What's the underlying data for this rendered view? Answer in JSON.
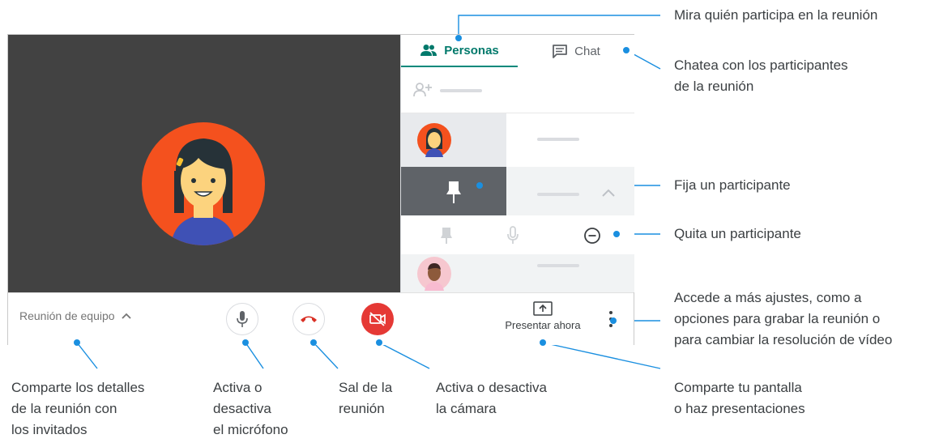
{
  "tabs": {
    "people": "Personas",
    "chat": "Chat"
  },
  "bottom_bar": {
    "meeting_name": "Reunión de equipo",
    "present_label": "Presentar ahora"
  },
  "annotations": {
    "people": "Mira quién participa en la reunión",
    "chat": "Chatea con los participantes\nde la reunión",
    "pin": "Fija un participante",
    "remove": "Quita un participante",
    "more": "Accede a más ajustes, como a\nopciones para grabar la reunión o\npara cambiar la resolución de vídeo",
    "present": "Comparte tu pantalla\no haz presentaciones",
    "details": "Comparte los detalles\nde la reunión con\nlos invitados",
    "mic": "Activa o\ndesactiva\nel micrófono",
    "hangup": "Sal de la\nreunión",
    "camera": "Activa o desactiva\nla cámara"
  },
  "colors": {
    "accent_teal": "#00796b",
    "annotation_blue": "#1a8fe0",
    "hangup_red": "#e53935",
    "video_bg": "#424242",
    "avatar_orange": "#f4511e"
  },
  "icons": [
    "people-icon",
    "chat-icon",
    "add-person-icon",
    "pin-icon",
    "mic-icon",
    "remove-icon",
    "chevron-up-icon",
    "hangup-icon",
    "camera-off-icon",
    "present-icon",
    "more-icon"
  ]
}
